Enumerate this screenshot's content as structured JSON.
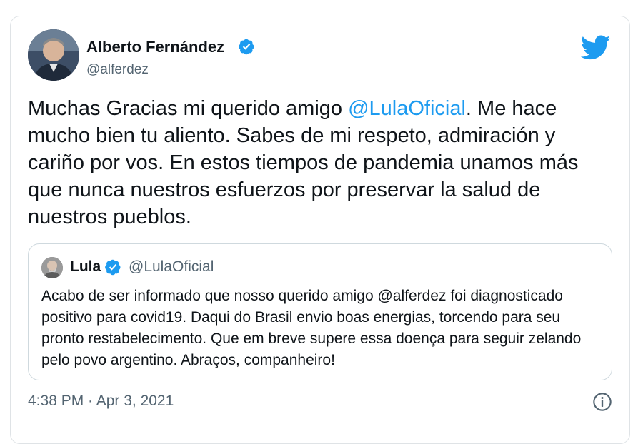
{
  "tweet": {
    "author": {
      "name": "Alberto Fernández",
      "handle": "@alferdez",
      "verified": true
    },
    "text_before_mention": "Muchas Gracias mi querido amigo ",
    "mention": "@LulaOficial",
    "text_after_mention": ". Me hace mucho bien tu aliento. Sabes de mi respeto, admiración y cariño por vos. En estos tiempos de pandemia unamos más que nunca nuestros esfuerzos por preservar la salud de nuestros pueblos.",
    "timestamp": "4:38 PM · Apr 3, 2021"
  },
  "quoted_tweet": {
    "author": {
      "name": "Lula",
      "handle": "@LulaOficial",
      "verified": true
    },
    "text": "Acabo de ser informado que nosso querido amigo @alferdez foi diagnosticado positivo para covid19. Daqui do Brasil envio boas energias, torcendo para seu pronto restabelecimento. Que em breve supere essa doença para seguir zelando pelo povo argentino. Abraços, companheiro!"
  },
  "colors": {
    "accent": "#1d9bf0",
    "text": "#0f1419",
    "secondary": "#536471",
    "border": "#cfd9de"
  },
  "icons": [
    "verified-badge-icon",
    "twitter-bird-icon",
    "info-icon"
  ]
}
